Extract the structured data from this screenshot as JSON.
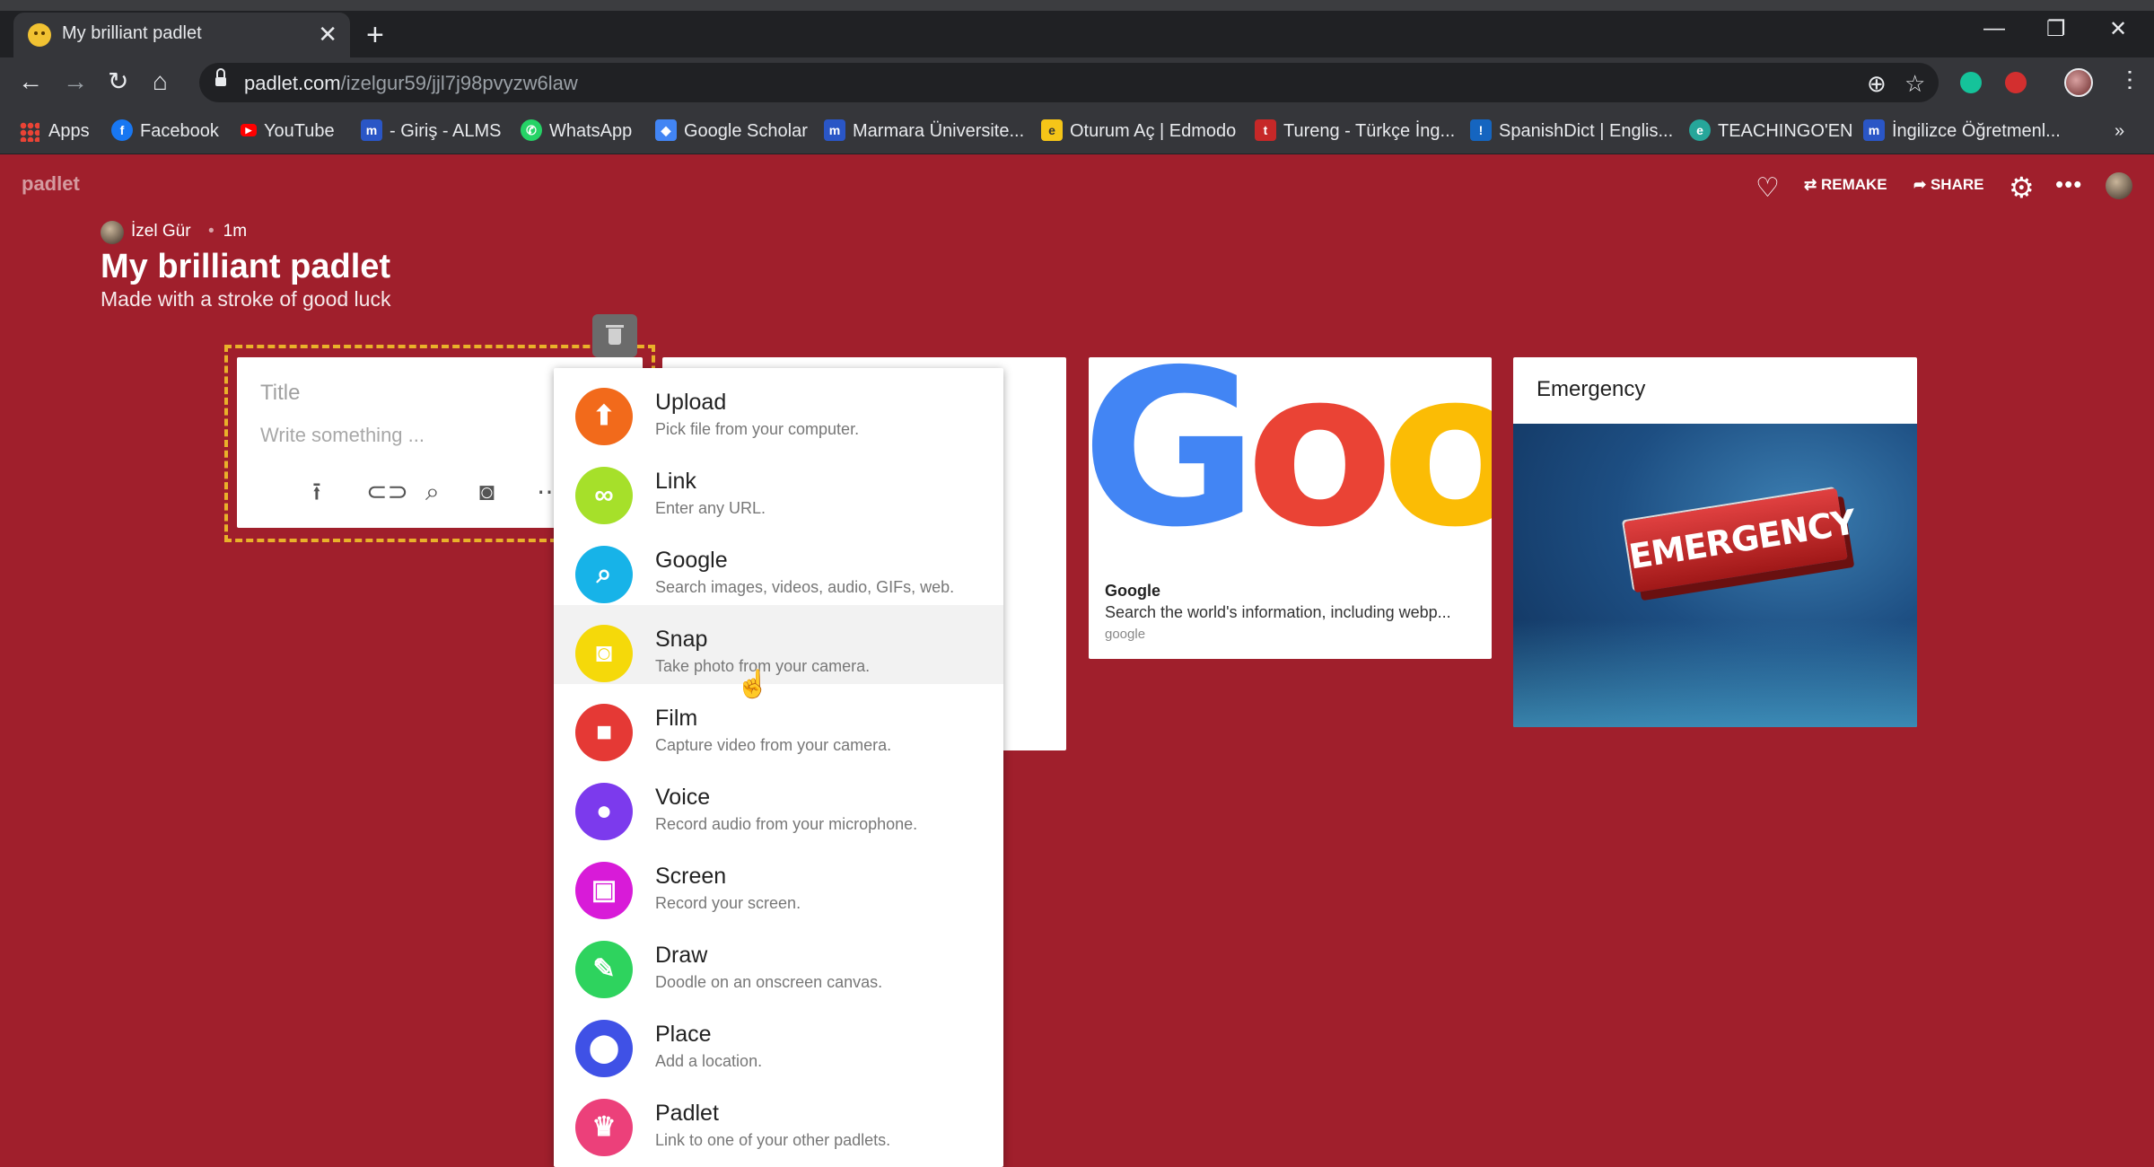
{
  "browser": {
    "tab_title": "My brilliant padlet",
    "tab_close": "✕",
    "new_tab": "+",
    "url_host": "padlet.com",
    "url_path": "/izelgur59/jjl7j98pvyzw6law",
    "bookmarks": [
      {
        "label": "Apps",
        "color": "#ea4335"
      },
      {
        "label": "Facebook",
        "color": "#1877f2"
      },
      {
        "label": "YouTube",
        "color": "#ff0000"
      },
      {
        "label": "- Giriş - ALMS",
        "color": "#2a56c6"
      },
      {
        "label": "WhatsApp",
        "color": "#25d366"
      },
      {
        "label": "Google Scholar",
        "color": "#4285f4"
      },
      {
        "label": "Marmara Üniversite...",
        "color": "#2a56c6"
      },
      {
        "label": "Oturum Aç | Edmodo",
        "color": "#f5c518"
      },
      {
        "label": "Tureng - Türkçe İng...",
        "color": "#c62828"
      },
      {
        "label": "SpanishDict | Englis...",
        "color": "#1565c0"
      },
      {
        "label": "TEACHINGO'EN",
        "color": "#26a69a"
      },
      {
        "label": "İngilizce Öğretmenl...",
        "color": "#2a56c6"
      }
    ],
    "bookmarks_overflow": "»"
  },
  "padlet": {
    "logo": "padlet",
    "remake_label": "REMAKE",
    "share_label": "SHARE",
    "author": "İzel Gür",
    "time": "1m",
    "title": "My brilliant padlet",
    "subtitle": "Made with a stroke of good luck"
  },
  "draft": {
    "title_placeholder": "Title",
    "body_placeholder": "Write something ..."
  },
  "menu": {
    "items": [
      {
        "label": "Upload",
        "desc": "Pick file from your computer.",
        "color": "#f26a1b"
      },
      {
        "label": "Link",
        "desc": "Enter any URL.",
        "color": "#a6e02a"
      },
      {
        "label": "Google",
        "desc": "Search images, videos, audio, GIFs, web.",
        "color": "#17b3e8"
      },
      {
        "label": "Snap",
        "desc": "Take photo from your camera.",
        "color": "#f5d90a"
      },
      {
        "label": "Film",
        "desc": "Capture video from your camera.",
        "color": "#e53935"
      },
      {
        "label": "Voice",
        "desc": "Record audio from your microphone.",
        "color": "#7c3aed"
      },
      {
        "label": "Screen",
        "desc": "Record your screen.",
        "color": "#d81bd8"
      },
      {
        "label": "Draw",
        "desc": "Doodle on an onscreen canvas.",
        "color": "#2ed35e"
      },
      {
        "label": "Place",
        "desc": "Add a location.",
        "color": "#3f51e6"
      },
      {
        "label": "Padlet",
        "desc": "Link to one of your other padlets.",
        "color": "#ec407a"
      }
    ]
  },
  "cards": {
    "google": {
      "logo_text": "Goog",
      "title": "Google",
      "desc": "Search the world's information, including webp...",
      "domain": "google"
    },
    "emergency": {
      "title": "Emergency",
      "sign_text": "EMERGENCY"
    }
  }
}
